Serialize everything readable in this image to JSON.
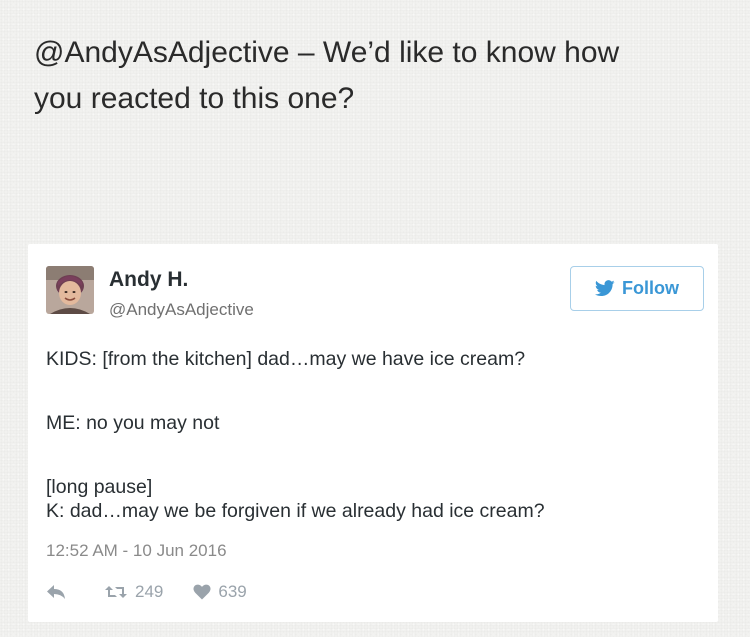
{
  "caption": {
    "line1": "@AndyAsAdjective – We’d like to know how",
    "line2": "you reacted to this one?"
  },
  "tweet": {
    "user": {
      "name": "Andy H.",
      "handle": "@AndyAsAdjective"
    },
    "follow_label": "Follow",
    "text_lines": [
      "KIDS: [from the kitchen] dad…may we have ice cream?",
      "ME: no you may not",
      "[long pause]",
      "K: dad…may we be forgiven if we already had ice cream?"
    ],
    "timestamp": "12:52 AM - 10 Jun 2016",
    "retweet_count": "249",
    "like_count": "639"
  },
  "colors": {
    "brand": "#3a97d6",
    "muted": "#9aa3ab"
  },
  "icons": {
    "reply": "reply-icon",
    "retweet": "retweet-icon",
    "like": "heart-icon",
    "follow": "twitter-bird-icon"
  }
}
